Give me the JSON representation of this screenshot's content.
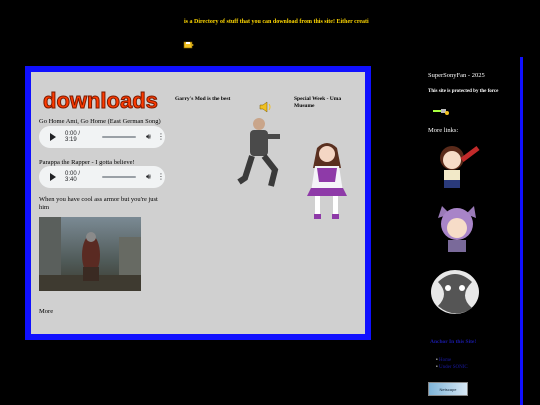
{
  "marquee": {
    "text": "is a Directory of stuff that you can download from this site! Either creati"
  },
  "main": {
    "logo_text": "downloads",
    "songs": [
      {
        "title": "Go Home Ami, Go Home (East German Song)",
        "time": "0:00 / 3:19"
      },
      {
        "title": "Parappa the Rapper - I gotta believe!",
        "time": "0:00 / 3:40"
      }
    ],
    "armor_caption": "When you have cool ass armor but you're just him",
    "more_label": "More",
    "garry_label": "Garry's Mod is the best",
    "special_label": "Special Week - Uma Musume"
  },
  "sidebar": {
    "copyright": "SuperSonyFan - 2025",
    "force_text": "This site is protected by the force",
    "more_links_label": "More links:",
    "nav_head": "Anchor In this Site!",
    "nav_items": [
      "Home",
      "Under SONIC"
    ],
    "banner_text": "Netscape"
  },
  "colors": {
    "panel_border": "#1010ff",
    "panel_bg": "#d0d0d0",
    "marquee": "#ffd700",
    "link": "#1a1aa6"
  }
}
